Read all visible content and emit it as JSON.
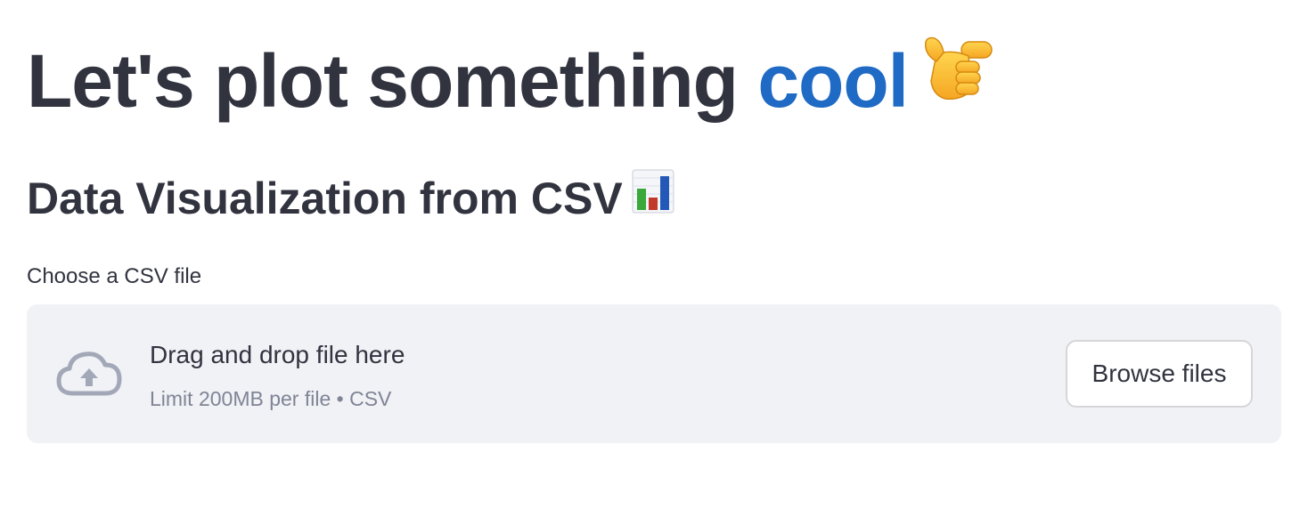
{
  "header": {
    "title_prefix": "Let's plot something ",
    "title_accent": "cool",
    "title_emoji": "call-me-hand-emoji",
    "accent_color": "#1f6ac4"
  },
  "section": {
    "subtitle": "Data Visualization from CSV",
    "subtitle_emoji": "bar-chart-emoji"
  },
  "uploader": {
    "label": "Choose a CSV file",
    "drop_text": "Drag and drop file here",
    "limit_text": "Limit 200MB per file • CSV",
    "browse_label": "Browse files",
    "icon": "cloud-upload-icon"
  }
}
